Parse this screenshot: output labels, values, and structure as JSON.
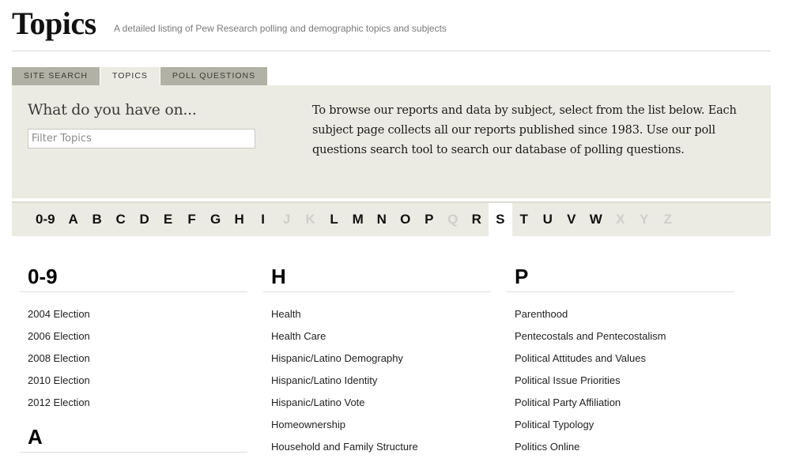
{
  "header": {
    "title": "Topics",
    "subtitle": "A detailed listing of Pew Research polling and demographic topics and subjects"
  },
  "tabs": [
    {
      "label": "SITE SEARCH",
      "active": false
    },
    {
      "label": "TOPICS",
      "active": true
    },
    {
      "label": "POLL QUESTIONS",
      "active": false
    }
  ],
  "filter": {
    "heading": "What do you have on...",
    "input_placeholder": "Filter Topics",
    "input_value": "",
    "description": "To browse our reports and data by subject, select from the list below. Each subject page collects all our reports published since 1983. Use our poll questions search tool to search our database of polling questions."
  },
  "letters": [
    {
      "label": "0-9",
      "state": "enabled"
    },
    {
      "label": "A",
      "state": "enabled"
    },
    {
      "label": "B",
      "state": "enabled"
    },
    {
      "label": "C",
      "state": "enabled"
    },
    {
      "label": "D",
      "state": "enabled"
    },
    {
      "label": "E",
      "state": "enabled"
    },
    {
      "label": "F",
      "state": "enabled"
    },
    {
      "label": "G",
      "state": "enabled"
    },
    {
      "label": "H",
      "state": "enabled"
    },
    {
      "label": "I",
      "state": "enabled"
    },
    {
      "label": "J",
      "state": "disabled"
    },
    {
      "label": "K",
      "state": "disabled"
    },
    {
      "label": "L",
      "state": "enabled"
    },
    {
      "label": "M",
      "state": "enabled"
    },
    {
      "label": "N",
      "state": "enabled"
    },
    {
      "label": "O",
      "state": "enabled"
    },
    {
      "label": "P",
      "state": "enabled"
    },
    {
      "label": "Q",
      "state": "disabled"
    },
    {
      "label": "R",
      "state": "enabled"
    },
    {
      "label": "S",
      "state": "active"
    },
    {
      "label": "T",
      "state": "enabled"
    },
    {
      "label": "U",
      "state": "enabled"
    },
    {
      "label": "V",
      "state": "enabled"
    },
    {
      "label": "W",
      "state": "enabled"
    },
    {
      "label": "X",
      "state": "disabled"
    },
    {
      "label": "Y",
      "state": "disabled"
    },
    {
      "label": "Z",
      "state": "disabled"
    }
  ],
  "columns": [
    {
      "sections": [
        {
          "heading": "0-9",
          "topics": [
            "2004 Election",
            "2006 Election",
            "2008 Election",
            "2010 Election",
            "2012 Election"
          ]
        },
        {
          "heading": "A",
          "topics": []
        }
      ]
    },
    {
      "sections": [
        {
          "heading": "H",
          "topics": [
            "Health",
            "Health Care",
            "Hispanic/Latino Demography",
            "Hispanic/Latino Identity",
            "Hispanic/Latino Vote",
            "Homeownership",
            "Household and Family Structure"
          ]
        }
      ]
    },
    {
      "sections": [
        {
          "heading": "P",
          "topics": [
            "Parenthood",
            "Pentecostals and Pentecostalism",
            "Political Attitudes and Values",
            "Political Issue Priorities",
            "Political Party Affiliation",
            "Political Typology",
            "Politics Online"
          ]
        }
      ]
    }
  ],
  "colors": {
    "panel_bg": "#ecebe3",
    "tab_inactive_bg": "#b1b2a5",
    "letter_disabled": "#cfcfca"
  }
}
